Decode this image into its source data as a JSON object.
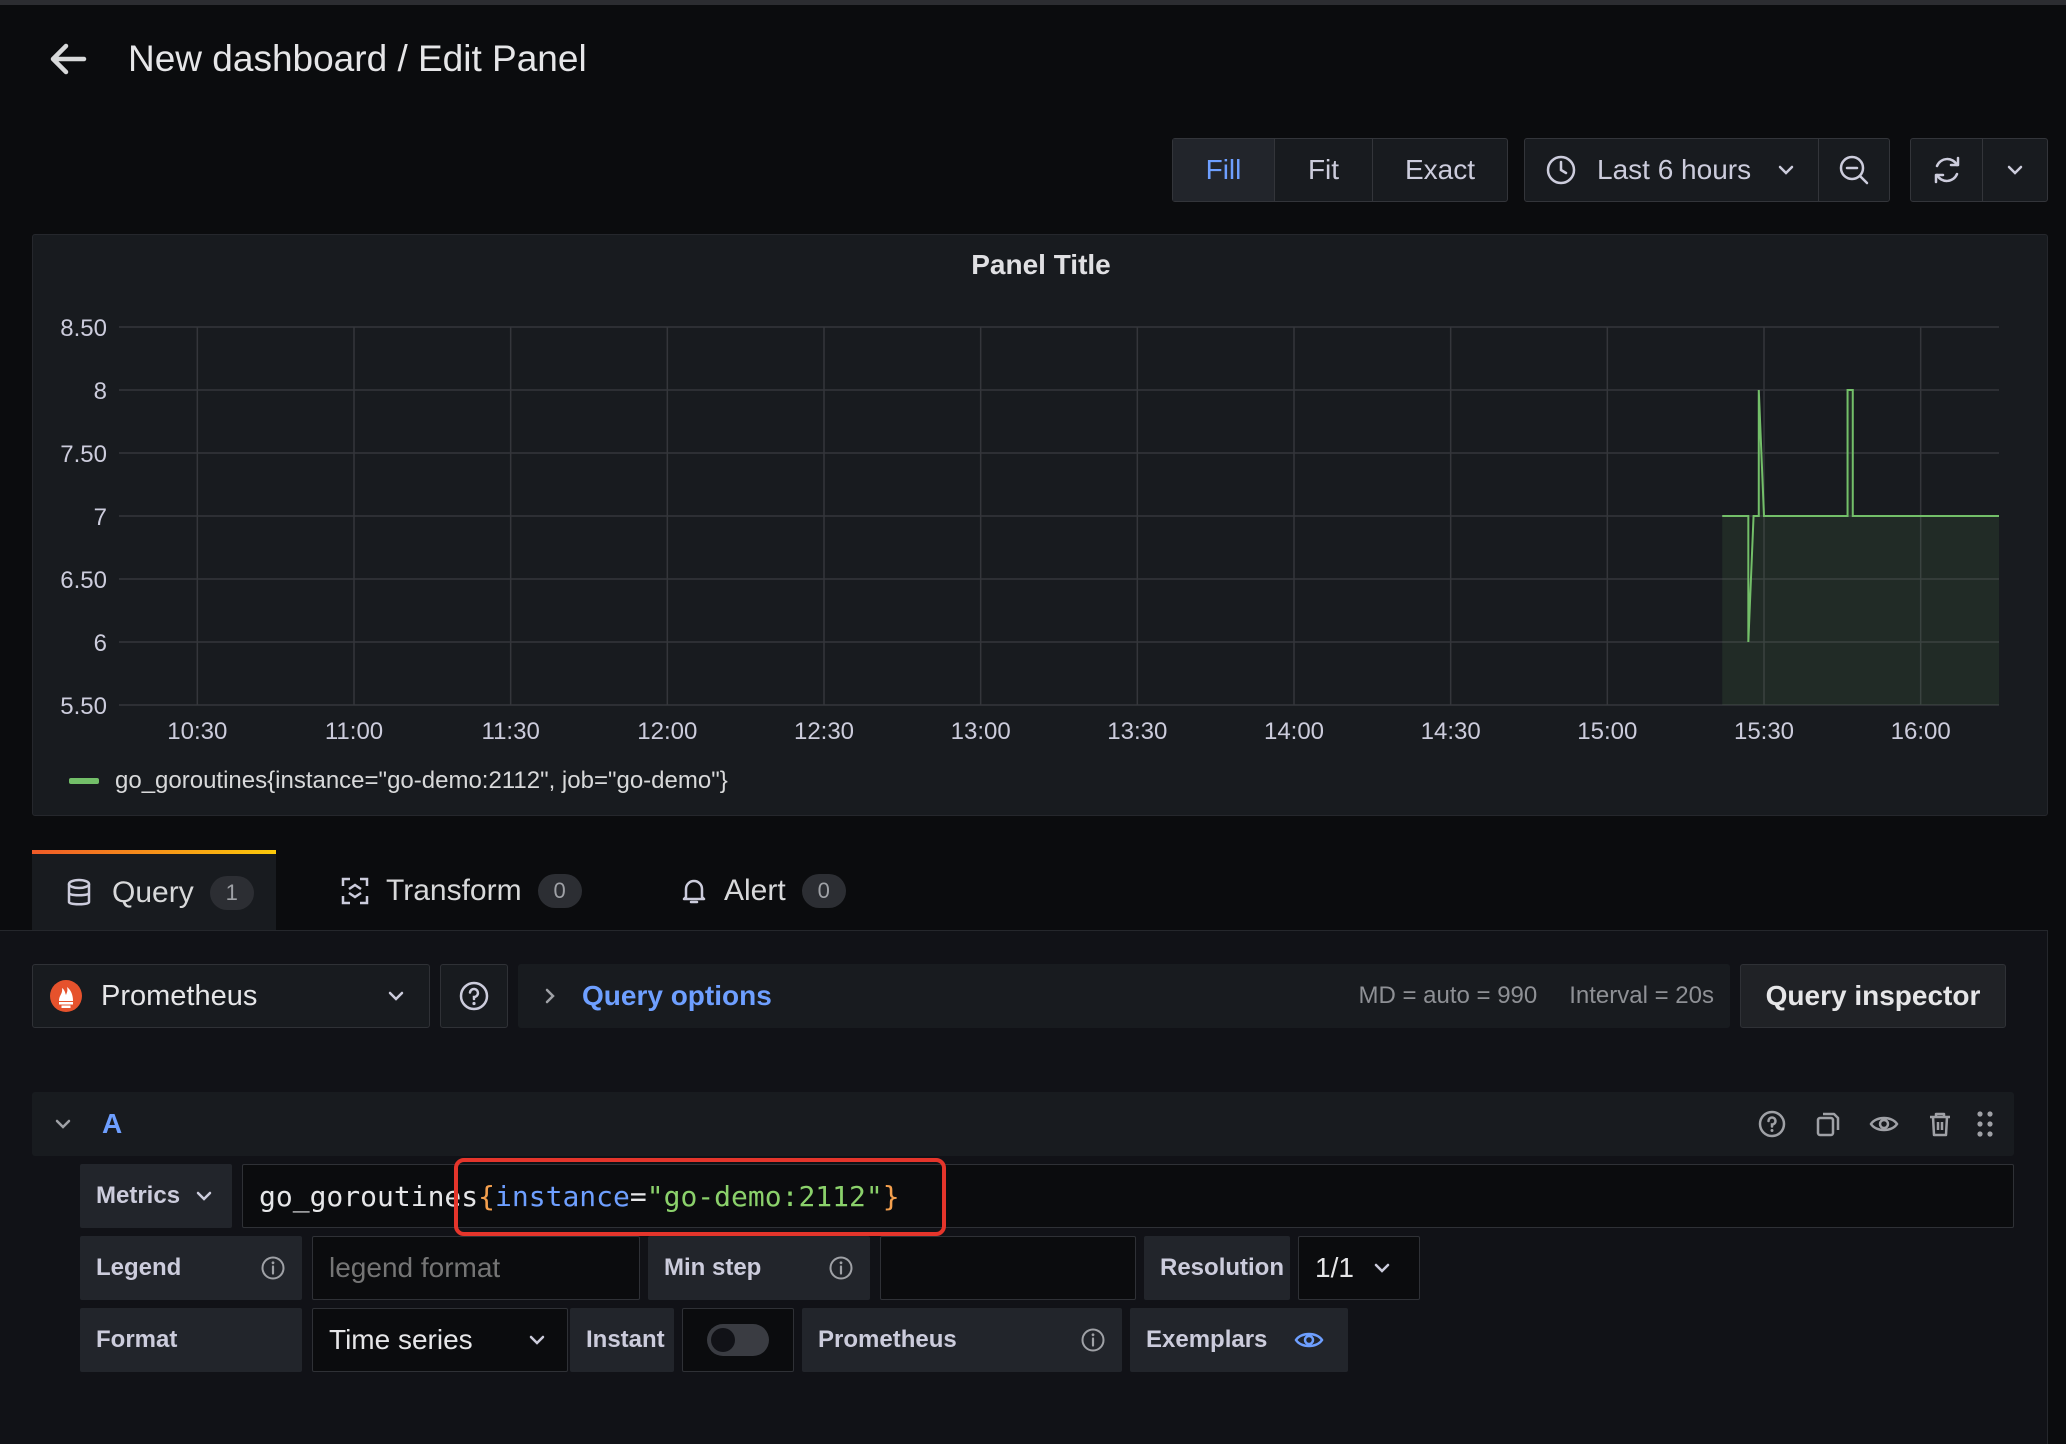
{
  "header": {
    "title": "New dashboard / Edit Panel"
  },
  "toolbar": {
    "fill_label": "Fill",
    "fit_label": "Fit",
    "exact_label": "Exact",
    "time_range": "Last 6 hours"
  },
  "panel": {
    "title": "Panel Title",
    "legend": "go_goroutines{instance=\"go-demo:2112\", job=\"go-demo\"}"
  },
  "chart_data": {
    "type": "line",
    "title": "Panel Title",
    "y_ticks": [
      "8.50",
      "8",
      "7.50",
      "7",
      "6.50",
      "6",
      "5.50"
    ],
    "ylim": [
      5.5,
      8.5
    ],
    "x_ticks": [
      "10:30",
      "11:00",
      "11:30",
      "12:00",
      "12:30",
      "13:00",
      "13:30",
      "14:00",
      "14:30",
      "15:00",
      "15:30",
      "16:00"
    ],
    "xlim": [
      "10:15",
      "16:15"
    ],
    "grid": true,
    "legend_position": "bottom-left",
    "series": [
      {
        "name": "go_goroutines{instance=\"go-demo:2112\", job=\"go-demo\"}",
        "color": "#73bf69",
        "fill": true,
        "x": [
          "15:22",
          "15:27",
          "15:27",
          "15:28",
          "15:29",
          "15:29",
          "15:30",
          "15:46",
          "15:46",
          "15:47",
          "15:47",
          "16:15"
        ],
        "y": [
          7,
          7,
          6,
          7,
          7,
          8,
          7,
          7,
          8,
          8,
          7,
          7
        ]
      }
    ]
  },
  "tabs": [
    {
      "label": "Query",
      "count": "1"
    },
    {
      "label": "Transform",
      "count": "0"
    },
    {
      "label": "Alert",
      "count": "0"
    }
  ],
  "query": {
    "datasource": "Prometheus",
    "options_label": "Query options",
    "md": "MD = auto = 990",
    "interval": "Interval = 20s",
    "inspector_label": "Query inspector",
    "ref_id": "A",
    "metrics_label": "Metrics",
    "expr_metric": "go_goroutines",
    "expr_open": "{",
    "expr_key": "instance",
    "expr_eq": "=",
    "expr_value": "\"go-demo:2112\"",
    "expr_close": "}",
    "legend_label": "Legend",
    "legend_placeholder": "legend format",
    "min_step_label": "Min step",
    "resolution_label": "Resolution",
    "resolution_value": "1/1",
    "format_label": "Format",
    "format_value": "Time series",
    "instant_label": "Instant",
    "prometheus_label": "Prometheus",
    "exemplars_label": "Exemplars"
  }
}
